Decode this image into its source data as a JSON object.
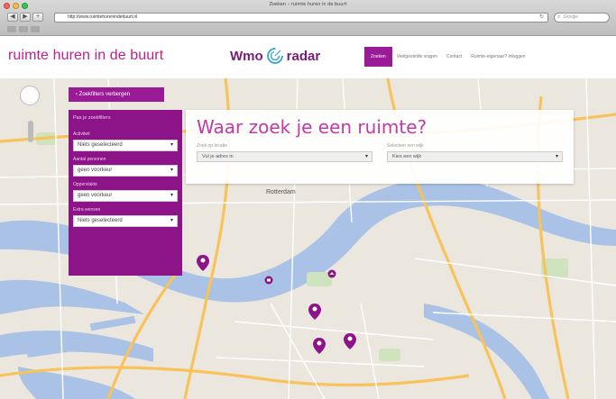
{
  "browser": {
    "window_title": "Zoeken – ruimte huren in de buurt",
    "url": "http://www.ruimtehurenindebuurt.nl",
    "search_placeholder": "Google",
    "nav_back": "◀",
    "nav_forward": "▶",
    "nav_add": "+"
  },
  "site": {
    "logo_text": "ruimte huren in de buurt",
    "partner_logo": {
      "left": "Wmo",
      "right": "radar"
    },
    "nav": [
      {
        "label": "Zoeken",
        "active": true
      },
      {
        "label": "Veelgestelde vragen",
        "active": false
      },
      {
        "label": "Contact",
        "active": false
      },
      {
        "label": "Ruimte-eigenaar? Inloggen",
        "active": false
      }
    ]
  },
  "map": {
    "hide_button": "Zoekfilters verbergen",
    "city_label": "Rotterdam",
    "colors": {
      "water": "#a9c2e6",
      "land": "#ebe7df",
      "road_major": "#f7c35a",
      "marker": "#8d1488"
    }
  },
  "filters": {
    "heading": "Pas je zoekfilters",
    "fields": [
      {
        "label": "Activiteit",
        "value": "Niets geselecteerd"
      },
      {
        "label": "Aantal personen",
        "value": "geen voorkeur"
      },
      {
        "label": "Oppervlakte",
        "value": "geen voorkeur"
      },
      {
        "label": "Extra wensen",
        "value": "Niets geselecteerd"
      }
    ]
  },
  "search": {
    "title": "Waar zoek je een ruimte?",
    "location": {
      "label": "Zoek op locatie",
      "value": "Vul je adres in"
    },
    "area": {
      "label": "Selecteer een wijk",
      "value": "Kies een wijk"
    }
  }
}
